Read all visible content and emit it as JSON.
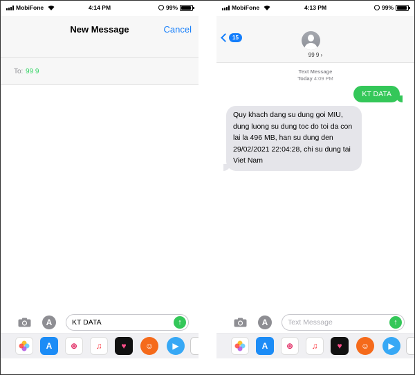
{
  "left_screen": {
    "status": {
      "carrier": "MobiFone",
      "time": "4:14 PM",
      "battery": "99%"
    },
    "header": {
      "title": "New Message",
      "cancel_label": "Cancel"
    },
    "to_field": {
      "label": "To:",
      "value": "99 9"
    },
    "input": {
      "value": "KT DATA",
      "placeholder": ""
    },
    "send_label": "↑"
  },
  "right_screen": {
    "status": {
      "carrier": "MobiFone",
      "time": "4:13 PM",
      "battery": "99%"
    },
    "header": {
      "back_badge": "15",
      "contact_name": "99 9 ›"
    },
    "thread_meta": {
      "kind": "Text Message",
      "day": "Today",
      "time": "4:09 PM"
    },
    "messages": [
      {
        "direction": "outgoing",
        "text": "KT DATA"
      },
      {
        "direction": "incoming",
        "text": "Quy khach dang su dung goi MIU, dung luong su dung toc do toi da con lai la 496 MB, han su dung den 29/02/2021 22:04:28, chi su dung tai Viet Nam"
      }
    ],
    "input": {
      "value": "",
      "placeholder": "Text Message"
    },
    "send_label": "↑"
  },
  "apps_glyph": "A",
  "drawer_icons": [
    "photos-icon",
    "app-store-icon",
    "image-search-icon",
    "music-icon",
    "heart-icon",
    "animoji-icon",
    "video-icon",
    "more-icon"
  ],
  "colors": {
    "accent": "#147efb",
    "sent_bubble": "#34c759",
    "received_bubble": "#e5e5ea",
    "to_value": "#2bd35e"
  }
}
